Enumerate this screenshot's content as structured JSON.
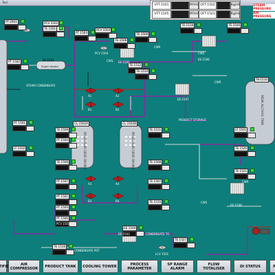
{
  "window": {
    "title": "Tool"
  },
  "header": {
    "row1": [
      {
        "tag": "VFT-1501",
        "value": "",
        "unit": "M³/Hr"
      },
      {
        "tag": "OFT-1502",
        "value": "",
        "unit": "Kg/Hr"
      }
    ],
    "row2": [
      {
        "tag": "VFT-1505",
        "value": "",
        "unit": "M³/Hr"
      },
      {
        "tag": "OFT-1503",
        "value": "",
        "unit": "Kg/Hr"
      }
    ],
    "alarms": [
      "STEAM PRESSURE",
      "AIR PRESSURE"
    ]
  },
  "instruments": [
    {
      "id": "pt2901",
      "tag": "PT-2901",
      "value": "",
      "unit": ""
    },
    {
      "id": "pcv1501",
      "tag": "PCV 1501",
      "value": "",
      "unit": ""
    },
    {
      "id": "te1501a",
      "tag": "TE 1501",
      "value": "",
      "unit": ""
    },
    {
      "id": "pt1502",
      "tag": "PT 1502",
      "value": "",
      "unit": ""
    },
    {
      "id": "pcv1503",
      "tag": "PCV 1503",
      "value": "",
      "unit": ""
    },
    {
      "id": "te1506",
      "tag": "TE-1506",
      "value": "",
      "unit": ""
    },
    {
      "id": "te1518",
      "tag": "TE 1518",
      "value": "",
      "unit": ""
    },
    {
      "id": "te1546",
      "tag": "TE-1546",
      "value": "",
      "unit": ""
    },
    {
      "id": "pt1503",
      "tag": "PT 1503",
      "value": "",
      "unit": ""
    },
    {
      "id": "te1508",
      "tag": "TE-1508",
      "value": "",
      "unit": ""
    },
    {
      "id": "te1512",
      "tag": "TE 1512",
      "value": "",
      "unit": ""
    },
    {
      "id": "te1510",
      "tag": "TE-1510",
      "value": "",
      "unit": ""
    },
    {
      "id": "pt1501",
      "tag": "PT 1501",
      "value": "",
      "unit": ""
    },
    {
      "id": "lt1502",
      "tag": "LT 1502",
      "value": "",
      "unit": ""
    },
    {
      "id": "te1509",
      "tag": "TE 1509",
      "value": "",
      "unit": ""
    },
    {
      "id": "te1511",
      "tag": "TE 1511",
      "value": "",
      "unit": ""
    },
    {
      "id": "pt1504",
      "tag": "PT 1504",
      "value": "",
      "unit": ""
    },
    {
      "id": "te1506b",
      "tag": "TE 1506",
      "value": "",
      "unit": ""
    },
    {
      "id": "te1508b",
      "tag": "TE 1508",
      "value": "",
      "unit": ""
    },
    {
      "id": "pt1507",
      "tag": "PT 1507",
      "value": "",
      "unit": ""
    },
    {
      "id": "te1507",
      "tag": "TE 1507",
      "value": "",
      "unit": ""
    },
    {
      "id": "pt1501b",
      "tag": "PT 1501",
      "value": "",
      "unit": ""
    },
    {
      "id": "lt1501",
      "tag": "LT 1501",
      "value": "",
      "unit": ""
    },
    {
      "id": "te1520",
      "tag": "TE 1520",
      "value": "",
      "unit": ""
    },
    {
      "id": "te1521",
      "tag": "TE 1521",
      "value": "",
      "unit": ""
    },
    {
      "id": "te1515",
      "tag": "TE 1515",
      "value": "",
      "unit": ""
    },
    {
      "id": "te1516",
      "tag": "TE 1516",
      "value": "",
      "unit": ""
    },
    {
      "id": "pt1505",
      "tag": "PT 1505",
      "value": "",
      "unit": ""
    },
    {
      "id": "pt1506",
      "tag": "PT 1506",
      "value": "",
      "unit": ""
    },
    {
      "id": "te1527",
      "tag": "TE 1527",
      "value": "",
      "unit": ""
    },
    {
      "id": "ee1504",
      "tag": "EE 1504",
      "value": "",
      "unit": ""
    }
  ],
  "equipment": {
    "sieve_a": "MOLECULAR SIEVE DRUM-A",
    "sieve_b": "MOLECULAR SIEVE DRUM-B",
    "sieve_a_tag": "CL 1502A",
    "sieve_b_tag": "CL 1502B",
    "tank": "WEAK ALCOHOL TANK",
    "tank_tag": "TK-1510",
    "superheater_tag": "EE-1504",
    "superheater": "Super Heater",
    "ee1503": "EE-1503",
    "ee1505": "EE-1505",
    "ee1506": "EE-1506",
    "ee1507": "EE-1507",
    "ee1508": "EE-1508",
    "steam_condensate": "STEAM CONDENSATE",
    "product_storage": "PRODUCT STORAGE",
    "condensate_to": "CONDENSATE TO",
    "condensate_pot": "CONDENSATE POT",
    "cwr": "CWR",
    "cws": "CWS",
    "pcv1503": "PCV 1503",
    "lcv1501": "LCV 1501",
    "pcv1504": "PCV 1504",
    "valves": [
      "A1",
      "A2",
      "B1",
      "B2",
      "A3",
      "A4",
      "B3",
      "B4"
    ]
  },
  "nav": {
    "buttons": [
      "RECTIFIER",
      "AIR COMPRESSOR",
      "PRODUCT TANK",
      "COOLING TOWER",
      "PROCESS PARAMETER",
      "SP RANGE ALARM",
      "FLOW TOTALISER",
      "DI STATUS",
      "P"
    ]
  }
}
